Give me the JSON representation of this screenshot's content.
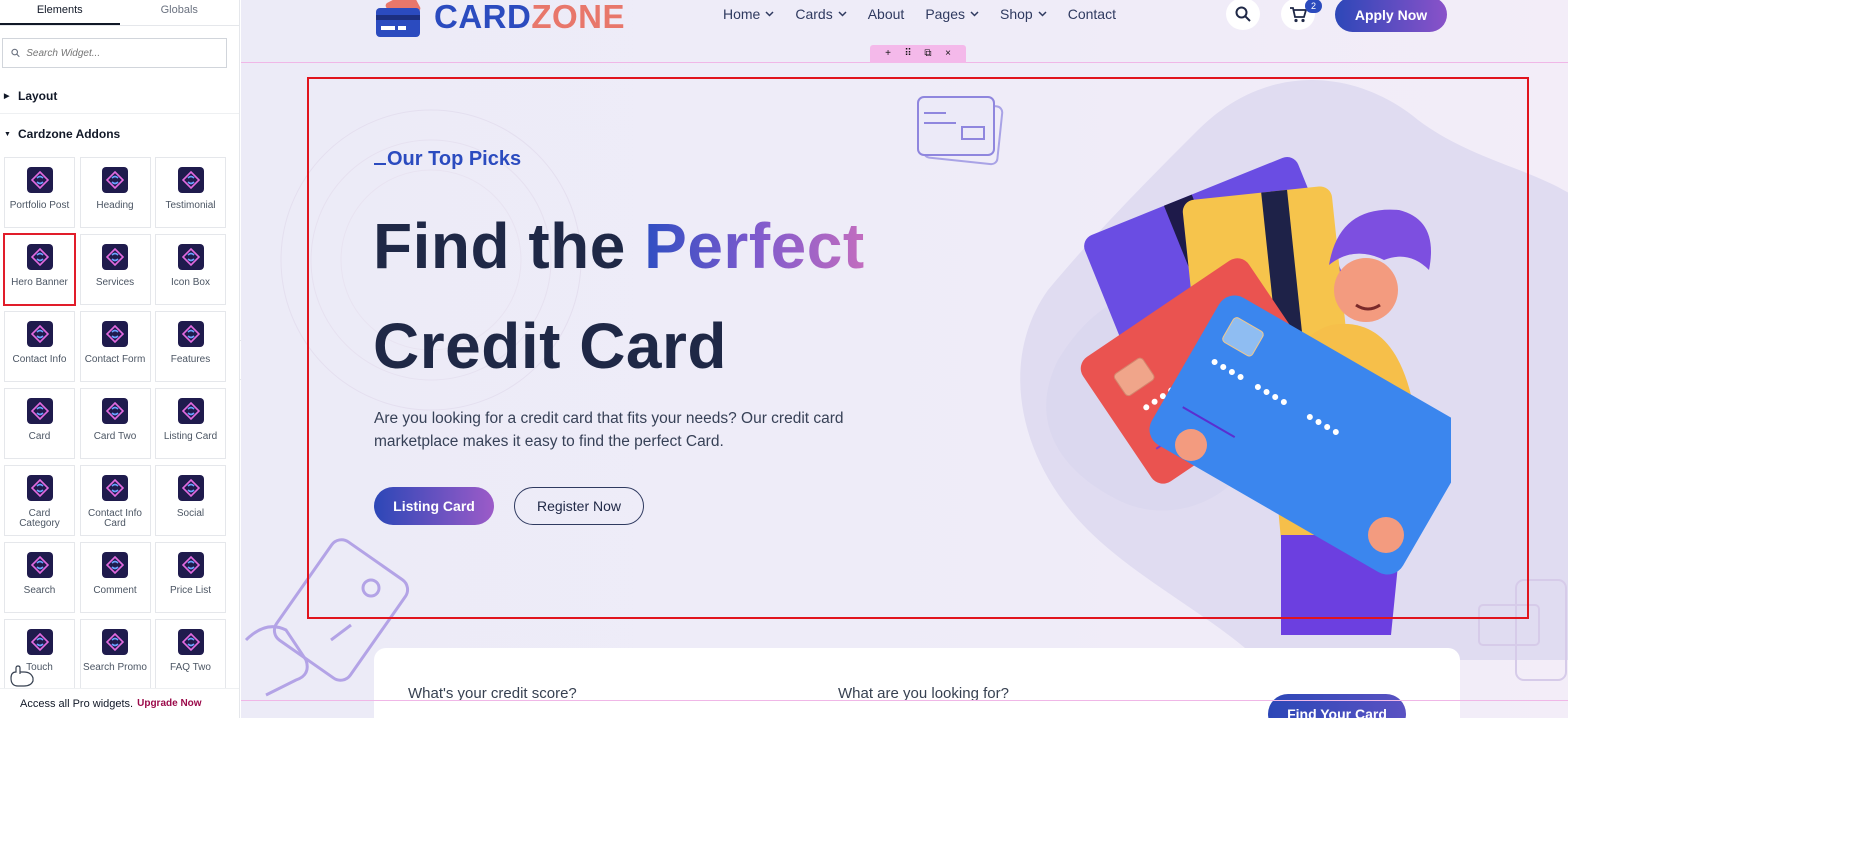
{
  "panel": {
    "tabs": [
      "Elements",
      "Globals"
    ],
    "search_placeholder": "Search Widget...",
    "sections": {
      "layout": "Layout",
      "addons": "Cardzone Addons"
    },
    "widgets": [
      "Portfolio Post",
      "Heading",
      "Testimonial",
      "Hero Banner",
      "Services",
      "Icon Box",
      "Contact Info",
      "Contact Form",
      "Features",
      "Card",
      "Card Two",
      "Listing Card",
      "Card Category",
      "Contact Info Card",
      "Social",
      "Search",
      "Comment",
      "Price List",
      "Touch",
      "Search Promo",
      "FAQ Two"
    ],
    "selected_widget": "Hero Banner",
    "promo_text": "Access all Pro widgets.",
    "promo_link": "Upgrade Now",
    "icon_color": "#1f1b4d"
  },
  "site": {
    "logo_part1": "CARD",
    "logo_part2": "ZONE",
    "nav": [
      {
        "label": "Home",
        "dropdown": true
      },
      {
        "label": "Cards",
        "dropdown": true
      },
      {
        "label": "About",
        "dropdown": false
      },
      {
        "label": "Pages",
        "dropdown": true
      },
      {
        "label": "Shop",
        "dropdown": true
      },
      {
        "label": "Contact",
        "dropdown": false
      }
    ],
    "cart_count": "2",
    "apply_label": "Apply Now",
    "brand_blue": "#2b4bbf",
    "brand_coral": "#e8776b"
  },
  "hero": {
    "eyebrow": "Our Top Picks",
    "title_line1_a": "Find the ",
    "title_line1_b": "Perfect",
    "title_line2": "Credit Card",
    "description": "Are you looking for a credit card that fits your needs? Our credit card marketplace makes it easy to find the perfect Card.",
    "primary_button": "Listing Card",
    "secondary_button": "Register Now"
  },
  "finder": {
    "label1": "What's your credit score?",
    "label2": "What are you looking for?",
    "button": "Find Your Card"
  },
  "editor_toolbar": {
    "add": "+",
    "move": "⠿",
    "duplicate": "⧉",
    "delete": "×"
  }
}
